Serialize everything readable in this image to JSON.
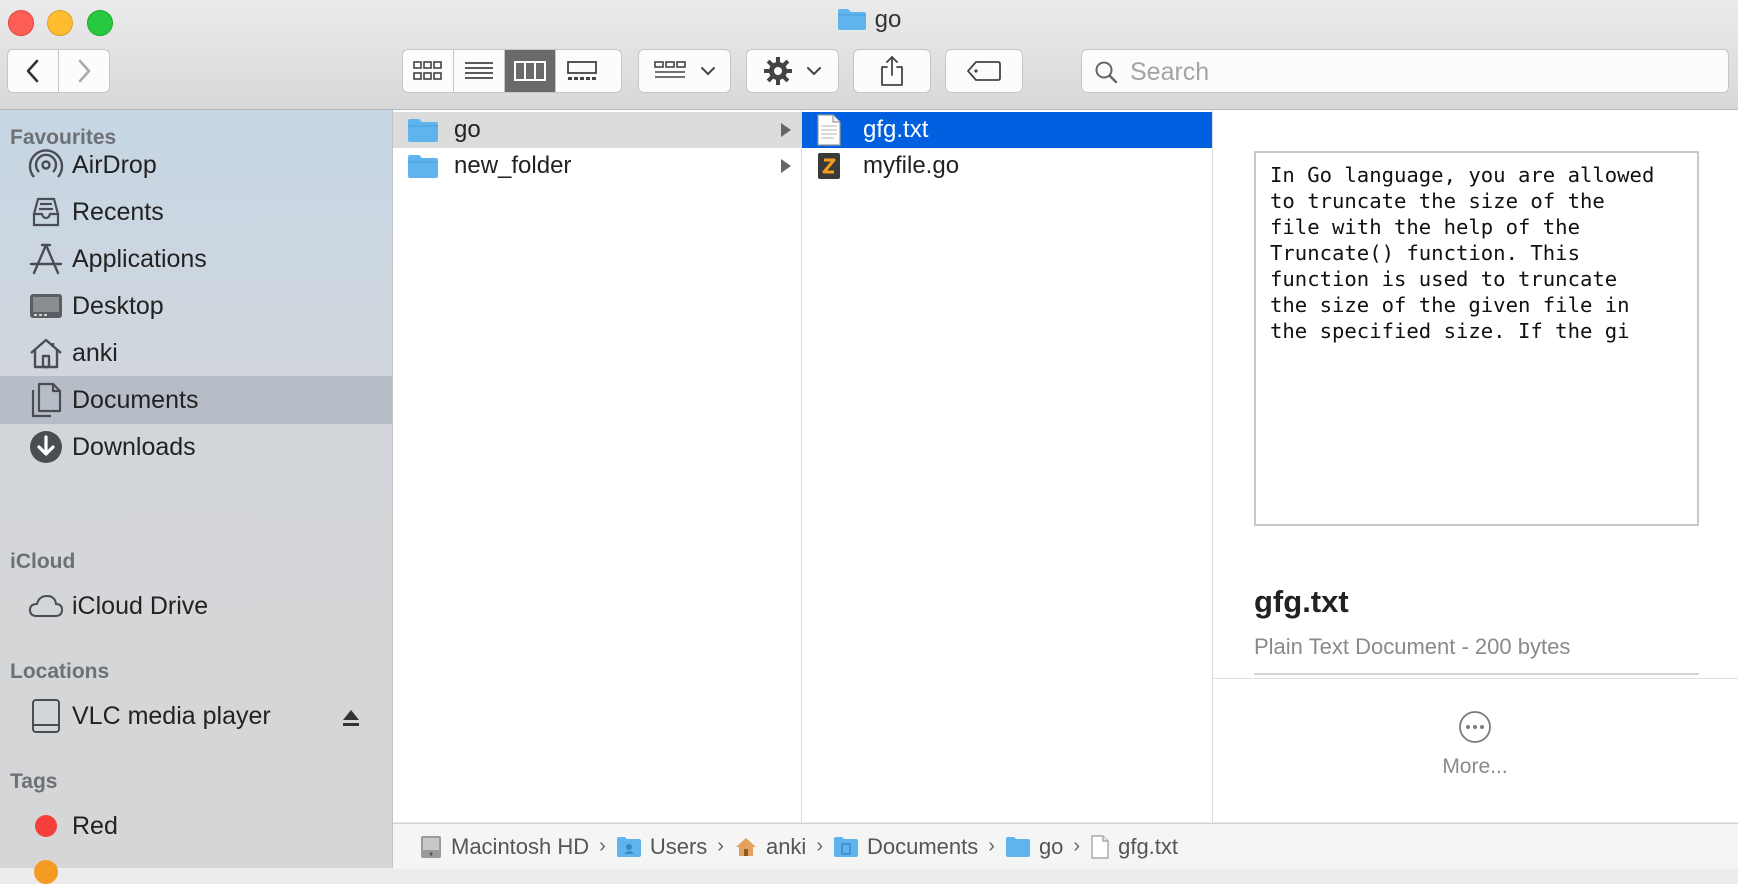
{
  "window": {
    "title": "go"
  },
  "search": {
    "placeholder": "Search",
    "value": ""
  },
  "sidebar": {
    "sections": {
      "favourites": "Favourites",
      "icloud": "iCloud",
      "locations": "Locations",
      "tags": "Tags"
    },
    "favourites": [
      {
        "label": "AirDrop",
        "icon": "airdrop-icon"
      },
      {
        "label": "Recents",
        "icon": "recents-icon"
      },
      {
        "label": "Applications",
        "icon": "applications-icon"
      },
      {
        "label": "Desktop",
        "icon": "desktop-icon"
      },
      {
        "label": "anki",
        "icon": "home-icon"
      },
      {
        "label": "Documents",
        "icon": "documents-icon",
        "selected": true
      },
      {
        "label": "Downloads",
        "icon": "downloads-icon"
      }
    ],
    "icloud": [
      {
        "label": "iCloud Drive",
        "icon": "cloud-icon"
      }
    ],
    "locations": [
      {
        "label": "VLC media player",
        "icon": "disk-icon"
      }
    ],
    "tags": [
      {
        "label": "Red",
        "color": "#f43f3b"
      }
    ]
  },
  "columns": {
    "col1": [
      {
        "label": "go",
        "icon": "folder-icon",
        "selected": true
      },
      {
        "label": "new_folder",
        "icon": "folder-icon"
      }
    ],
    "col2": [
      {
        "label": "gfg.txt",
        "icon": "text-file-icon",
        "selected": true
      },
      {
        "label": "myfile.go",
        "icon": "go-file-icon"
      }
    ]
  },
  "preview": {
    "text": "In Go language, you are allowed\nto truncate the size of the\nfile with the help of the\nTruncate() function. This\nfunction is used to truncate\nthe size of the given file in\nthe specified size. If the gi",
    "name": "gfg.txt",
    "kind": "Plain Text Document - 200 bytes",
    "more_label": "More..."
  },
  "pathbar": {
    "crumbs": [
      {
        "label": "Macintosh HD",
        "icon": "hard-drive-icon"
      },
      {
        "label": "Users",
        "icon": "users-folder-icon"
      },
      {
        "label": "anki",
        "icon": "home-icon"
      },
      {
        "label": "Documents",
        "icon": "documents-folder-icon"
      },
      {
        "label": "go",
        "icon": "folder-icon"
      },
      {
        "label": "gfg.txt",
        "icon": "text-file-icon"
      }
    ],
    "separator": "›"
  },
  "colors": {
    "selection_blue": "#0060df",
    "folder_blue": "#5fb4ee",
    "sidebar_selected": "#b6bdc6"
  }
}
